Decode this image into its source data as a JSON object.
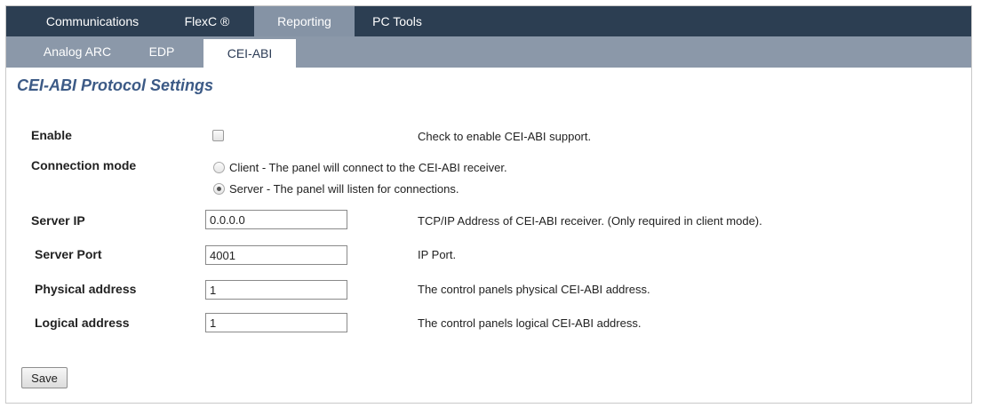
{
  "topnav": {
    "tabs": [
      {
        "label": "Communications"
      },
      {
        "label": "FlexC ®"
      },
      {
        "label": "Reporting"
      },
      {
        "label": "PC Tools"
      }
    ],
    "active": "Reporting"
  },
  "subnav": {
    "tabs": [
      {
        "label": "Analog ARC"
      },
      {
        "label": "EDP"
      },
      {
        "label": "CEI-ABI"
      }
    ],
    "active": "CEI-ABI"
  },
  "page": {
    "title": "CEI-ABI Protocol Settings"
  },
  "form": {
    "enable": {
      "label": "Enable",
      "checked": false,
      "description": "Check to enable CEI-ABI support."
    },
    "connection_mode": {
      "label": "Connection mode",
      "options": [
        {
          "text": "Client - The panel will connect to the CEI-ABI receiver.",
          "selected": false
        },
        {
          "text": "Server - The panel will listen for connections.",
          "selected": true
        }
      ]
    },
    "server_ip": {
      "label": "Server IP",
      "value": "0.0.0.0",
      "description": "TCP/IP Address of CEI-ABI receiver. (Only required in client mode)."
    },
    "server_port": {
      "label": "Server Port",
      "value": "4001",
      "description": "IP Port."
    },
    "physical_address": {
      "label": "Physical address",
      "value": "1",
      "description": "The control panels physical CEI-ABI address."
    },
    "logical_address": {
      "label": "Logical address",
      "value": "1",
      "description": "The control panels logical CEI-ABI address."
    }
  },
  "actions": {
    "save_label": "Save"
  },
  "colors": {
    "topnav_bg": "#2c3e52",
    "active_tab_bg": "#8593a5",
    "subnav_bg": "#8b98a9",
    "title_color": "#3c5a86"
  }
}
